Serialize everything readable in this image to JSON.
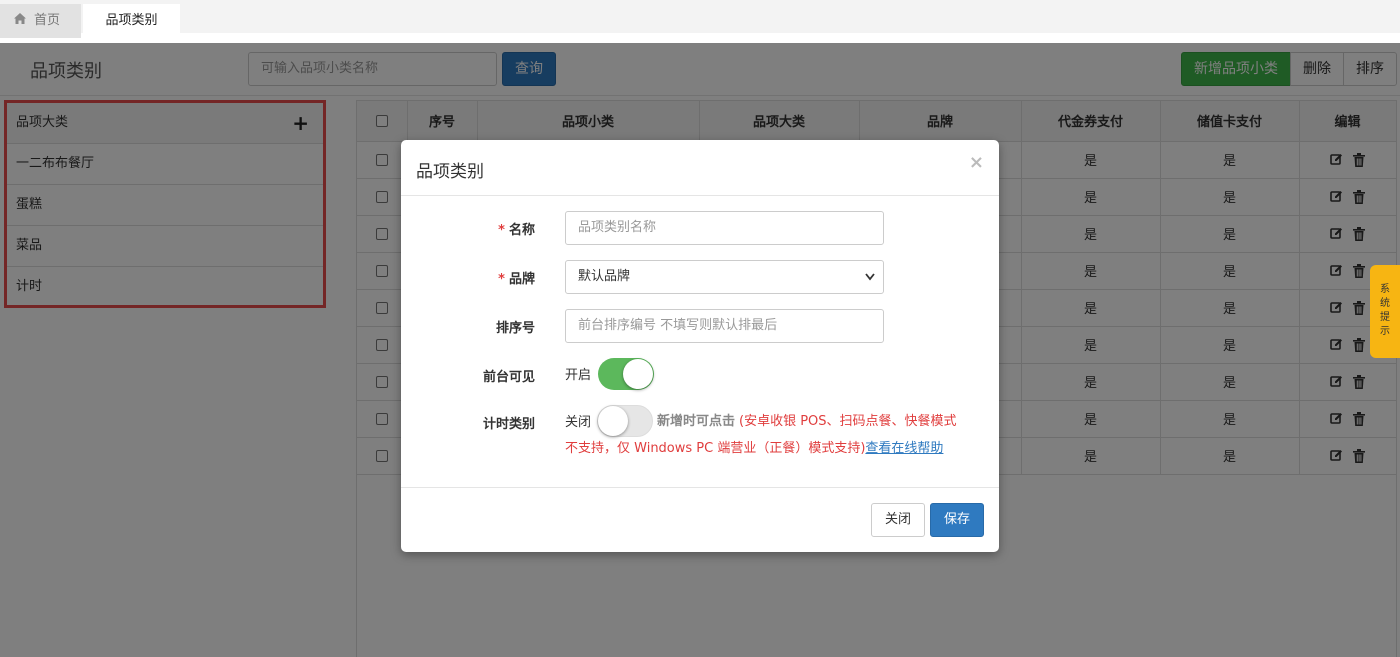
{
  "tabs": {
    "home": "首页",
    "active": "品项类别"
  },
  "page": {
    "title": "品项类别",
    "search_placeholder": "可输入品项小类名称",
    "query_label": "查询",
    "add_label": "新增品项小类",
    "delete_label": "删除",
    "sort_label": "排序"
  },
  "category_list": {
    "header": "品项大类",
    "items": [
      "一二布布餐厅",
      "蛋糕",
      "菜品",
      "计时"
    ]
  },
  "table": {
    "columns": [
      "序号",
      "品项小类",
      "品项大类",
      "品牌",
      "代金券支付",
      "储值卡支付",
      "编辑"
    ],
    "row_value": "是",
    "row_count": 9
  },
  "side_tip": "系统提示",
  "modal": {
    "title": "品项类别",
    "close_x": "×",
    "name_label": "名称",
    "name_placeholder": "品项类别名称",
    "brand_label": "品牌",
    "brand_value": "默认品牌",
    "order_label": "排序号",
    "order_placeholder": "前台排序编号 不填写则默认排最后",
    "visible_label": "前台可见",
    "visible_state": "开启",
    "timing_label": "计时类别",
    "timing_state": "关闭",
    "note_gray": "新增时可点击",
    "note_red_1": "(安卓收银 POS、扫码点餐、快餐模式",
    "note_red_2": "不支持，仅 Windows PC 端营业（正餐）模式支持)",
    "help_link": "查看在线帮助",
    "close_button": "关闭",
    "save_button": "保存"
  }
}
